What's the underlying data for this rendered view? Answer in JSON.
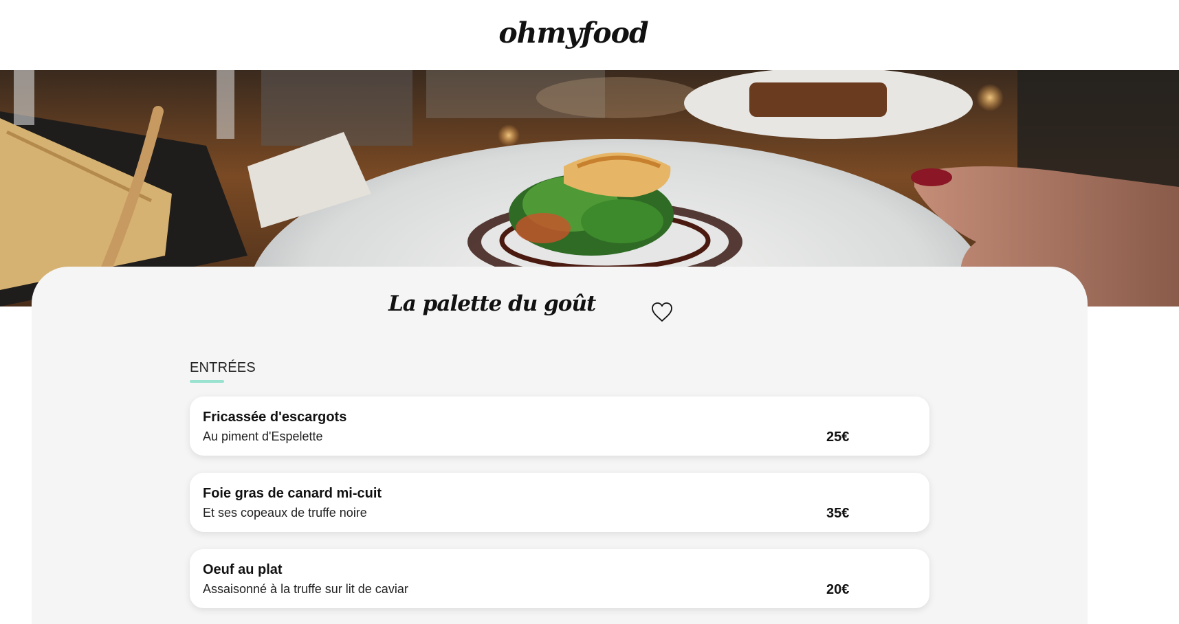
{
  "header": {
    "logo": "ohmyfood"
  },
  "hero": {
    "image": "plated-fish-dish-photo"
  },
  "restaurant": {
    "name": "La palette du goût",
    "favorite_icon": "heart-outline-icon"
  },
  "menu": {
    "section": "ENTRÉES",
    "accent_color": "#99e2d0",
    "dishes": [
      {
        "name": "Fricassée d'escargots",
        "description": "Au piment d'Espelette",
        "price": "25€"
      },
      {
        "name": "Foie gras de canard mi-cuit",
        "description": "Et ses copeaux de truffe noire",
        "price": "35€"
      },
      {
        "name": "Oeuf au plat",
        "description": "Assaisonné à la truffe sur lit de caviar",
        "price": "20€"
      }
    ]
  }
}
